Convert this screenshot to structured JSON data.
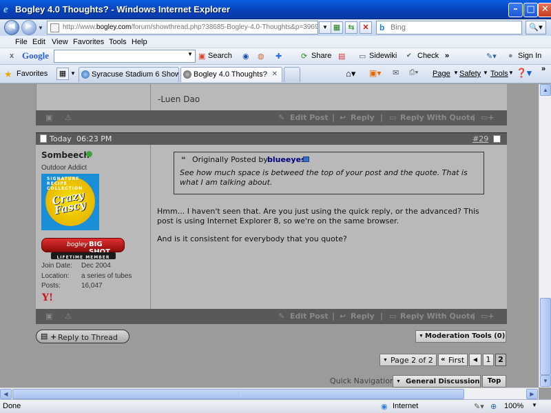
{
  "window": {
    "title": "Bogley 4.0 Thoughts? - Windows Internet Explorer"
  },
  "address": {
    "url_prefix": "http://www.",
    "url_domain": "bogley.com",
    "url_rest": "/forum/showthread.php?38685-Bogley-4.0-Thoughts&p=396905#p",
    "search_placeholder": "Bing"
  },
  "menu": [
    "File",
    "Edit",
    "View",
    "Favorites",
    "Tools",
    "Help"
  ],
  "google_toolbar": {
    "logo": "Google",
    "search_label": "Search",
    "share_label": "Share",
    "sidewiki_label": "Sidewiki",
    "check_label": "Check",
    "more_label": "»",
    "signin_label": "Sign In"
  },
  "favorites_bar": {
    "favorites_label": "Favorites",
    "tabs": [
      "Syracuse Stadium 6 Showtim...",
      "Bogley 4.0 Thoughts?"
    ],
    "commands": [
      "Page",
      "Safety",
      "Tools"
    ]
  },
  "prev_post": {
    "signature": "-Luen Dao"
  },
  "post_actions": {
    "edit": "Edit Post",
    "reply": "Reply",
    "quote": "Reply With Quote"
  },
  "post": {
    "date": "Today",
    "time": "06:23 PM",
    "number": "#29",
    "username": "Sombeech",
    "user_title": "Outdoor Addict",
    "avatar_text": "Crazy Fascy",
    "avatar_ring": "SIGNATURE RECIPE COLLECTION",
    "badge_brand": "bogley",
    "badge_label": "BIG SHOT",
    "badge_sub": "LIFETIME MEMBER",
    "info_labels": [
      "Join Date:",
      "Location:",
      "Posts:"
    ],
    "info_values": [
      "Dec 2004",
      "a series of tubes",
      "16,047"
    ],
    "quote_prefix": "Originally Posted by",
    "quote_author": "blueeyes",
    "quote_text": "See how much space is betweed the top of your post and the quote. That is what I am talking about.",
    "body_p1": "Hmm... I haven't seen that. Are you just using the quick reply, or the advanced? This post is using Internet Explorer 8, so we're on the same browser.",
    "body_p2": "And is it consistent for everybody that you quote?"
  },
  "thread_controls": {
    "reply_to_thread": "Reply to Thread",
    "moderation_tools": "Moderation Tools (0)",
    "page_of": "Page 2 of 2",
    "first": "First",
    "pages": [
      "1",
      "2"
    ],
    "quick_nav_label": "Quick Navigation",
    "quick_nav_value": "General Discussion",
    "top": "Top"
  },
  "status": {
    "left": "Done",
    "zone": "Internet",
    "zoom": "100%"
  },
  "colors": {
    "titlebar": "#0a50d0",
    "post_header": "#5a5a5a",
    "online_dot": "#3ca43c",
    "quote_author": "#000080"
  }
}
